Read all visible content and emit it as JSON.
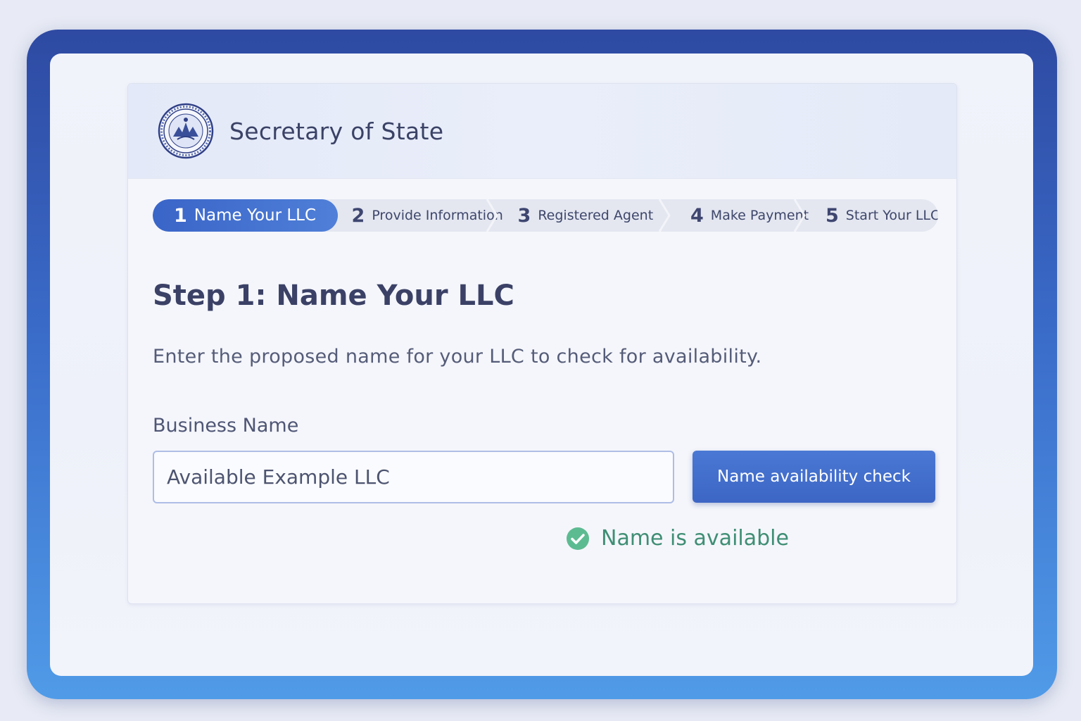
{
  "header": {
    "title": "Secretary of State"
  },
  "stepper": {
    "steps": [
      {
        "number": "1",
        "label": "Name Your LLC",
        "active": true
      },
      {
        "number": "2",
        "label": "Provide Information"
      },
      {
        "number": "3",
        "label": "Registered Agent"
      },
      {
        "number": "4",
        "label": "Make Payment"
      },
      {
        "number": "5",
        "label": "Start Your LLC"
      }
    ]
  },
  "form": {
    "title": "Step 1: Name Your LLC",
    "instructions": "Enter the proposed name for your LLC to check for availability.",
    "business_name_label": "Business Name",
    "business_name_value": "Available Example LLC",
    "check_button_label": "Name availability check",
    "status_text": "Name is available",
    "status_icon": "check-circle-icon",
    "status_color": "#3f8e74"
  },
  "colors": {
    "accent": "#3d66c4",
    "frame_top": "#2e4aa2",
    "frame_bottom": "#509be8"
  }
}
